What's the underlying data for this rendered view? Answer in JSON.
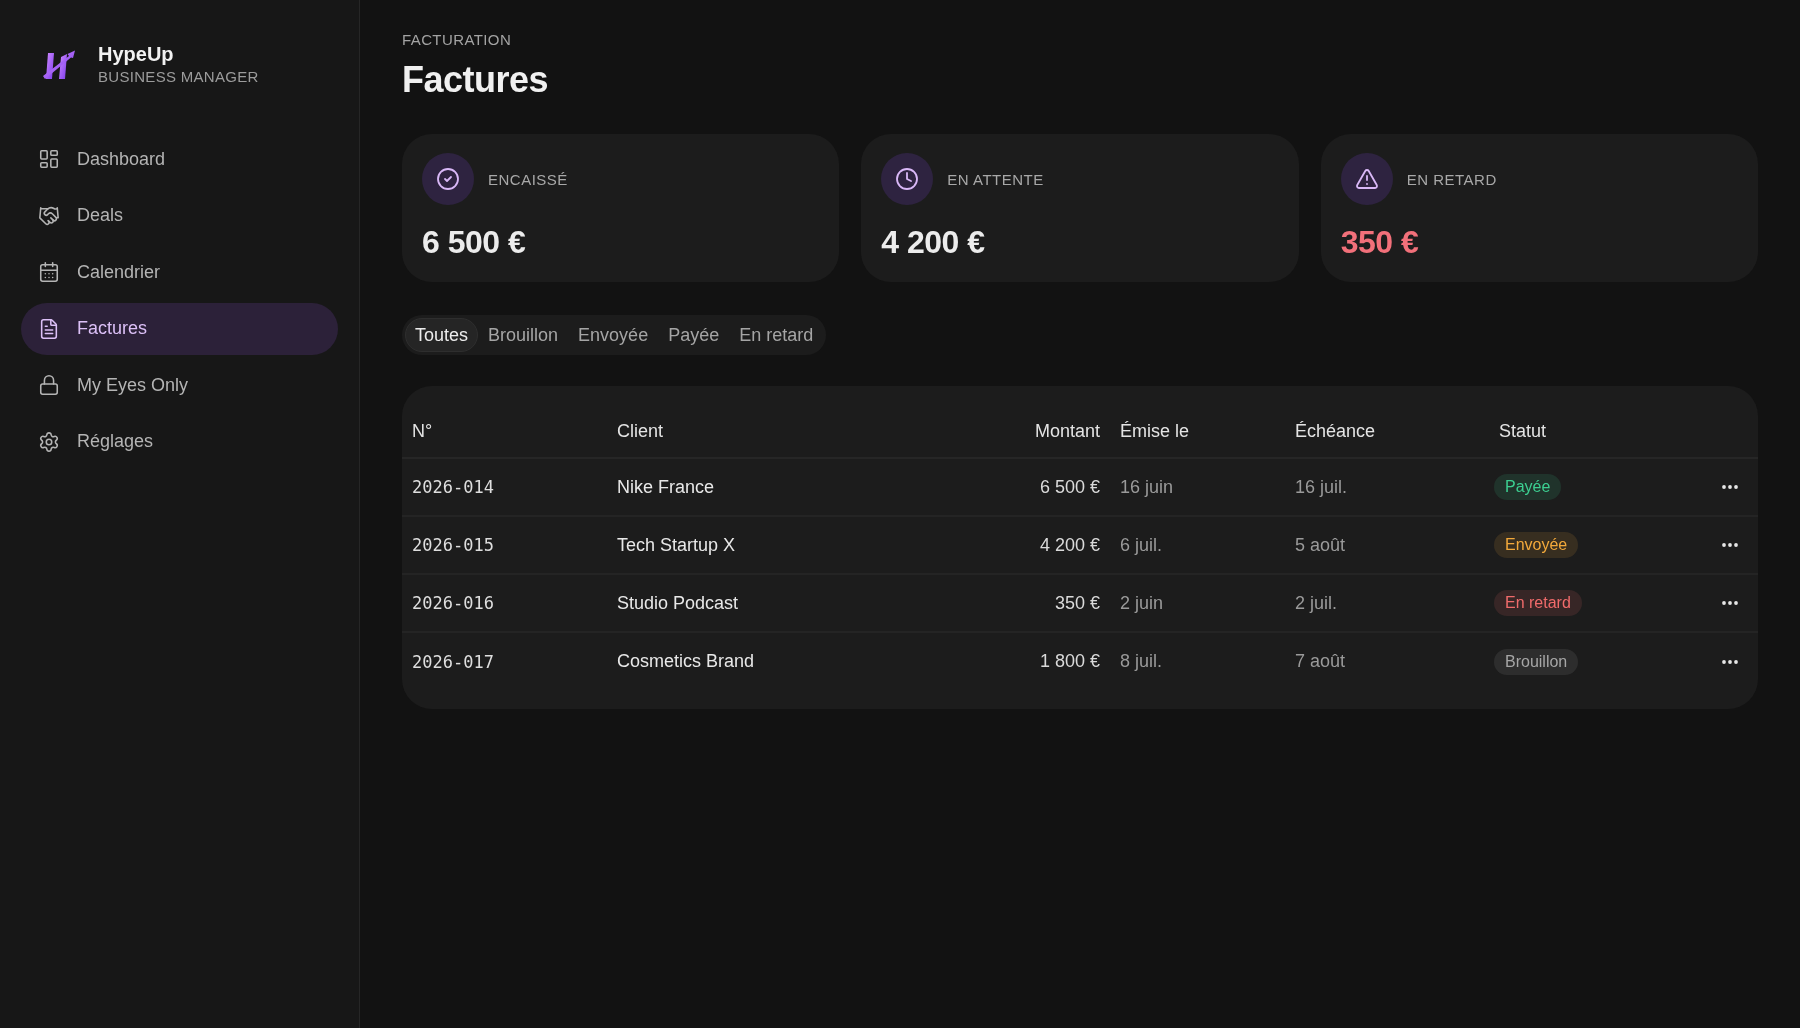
{
  "sidebar": {
    "brand": {
      "name": "HypeUp",
      "tagline": "BUSINESS MANAGER"
    },
    "items": [
      {
        "label": "Dashboard",
        "selected": false
      },
      {
        "label": "Deals",
        "selected": false
      },
      {
        "label": "Calendrier",
        "selected": false
      },
      {
        "label": "Factures",
        "selected": true
      },
      {
        "label": "My Eyes Only",
        "selected": false
      },
      {
        "label": "Réglages",
        "selected": false
      }
    ]
  },
  "header": {
    "eyebrow": "FACTURATION",
    "title": "Factures"
  },
  "cards": [
    {
      "label": "ENCAISSÉ",
      "value": "6 500 €",
      "color": "#ececec"
    },
    {
      "label": "EN ATTENTE",
      "value": "4 200 €",
      "color": "#ececec"
    },
    {
      "label": "EN RETARD",
      "value": "350 €",
      "color": "#f2707a"
    }
  ],
  "filter_tabs": [
    {
      "label": "Toutes",
      "selected": true
    },
    {
      "label": "Brouillon",
      "selected": false
    },
    {
      "label": "Envoyée",
      "selected": false
    },
    {
      "label": "Payée",
      "selected": false
    },
    {
      "label": "En retard",
      "selected": false
    }
  ],
  "table": {
    "columns": [
      "N°",
      "Client",
      "Montant",
      "Émise le",
      "Échéance",
      "Statut"
    ],
    "rows": [
      {
        "number": "2026-014",
        "client": "Nike France",
        "amount": "6 500 €",
        "issued": "16 juin",
        "due": "16 juil.",
        "status": {
          "label": "Payée",
          "color": "#3ccf91"
        }
      },
      {
        "number": "2026-015",
        "client": "Tech Startup X",
        "amount": "4 200 €",
        "issued": "6 juil.",
        "due": "5 août",
        "status": {
          "label": "Envoyée",
          "color": "#f2a93b"
        }
      },
      {
        "number": "2026-016",
        "client": "Studio Podcast",
        "amount": "350 €",
        "issued": "2 juin",
        "due": "2 juil.",
        "status": {
          "label": "En retard",
          "color": "#f06b6b"
        }
      },
      {
        "number": "2026-017",
        "client": "Cosmetics Brand",
        "amount": "1 800 €",
        "issued": "8 juil.",
        "due": "7 août",
        "status": {
          "label": "Brouillon",
          "color": "#a6a6a6"
        }
      }
    ]
  }
}
